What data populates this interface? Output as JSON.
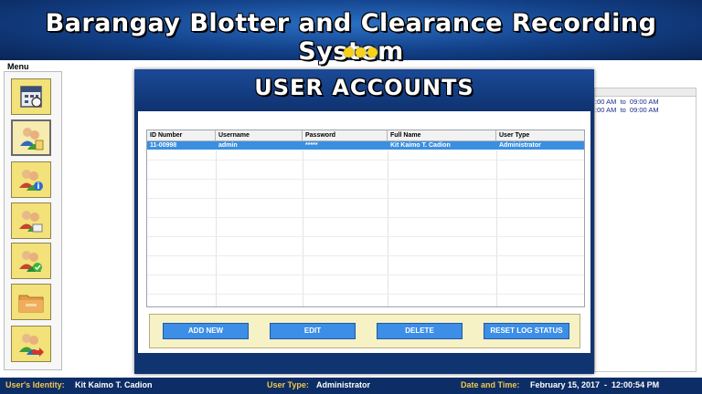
{
  "header": {
    "title": "Barangay Blotter and Clearance Recording System",
    "accent_color": "#f6d21a"
  },
  "menu": {
    "label": "Menu",
    "items": [
      {
        "icon": "calendar-icon"
      },
      {
        "icon": "users-icon",
        "active": true
      },
      {
        "icon": "user-info-icon"
      },
      {
        "icon": "users-edit-icon"
      },
      {
        "icon": "user-check-icon"
      },
      {
        "icon": "folder-icon"
      },
      {
        "icon": "user-logout-icon"
      }
    ]
  },
  "right_panel": {
    "lines": [
      ":00 AM  to  09:00 AM",
      ":00 AM  to  09:00 AM"
    ]
  },
  "dialog": {
    "title": "USER ACCOUNTS",
    "table": {
      "columns": [
        "ID Number",
        "Username",
        "Password",
        "Full Name",
        "User Type"
      ],
      "rows": [
        [
          "11-00998",
          "admin",
          "*****",
          "Kit Kaimo T. Cadion",
          "Administrator"
        ]
      ],
      "selected_row": 0
    },
    "buttons": {
      "add_new": "ADD NEW",
      "edit": "EDIT",
      "delete": "DELETE",
      "reset_log": "RESET LOG STATUS"
    }
  },
  "status_bar": {
    "identity_label": "User's Identity:",
    "identity_value": "Kit Kaimo T. Cadion",
    "type_label": "User Type:",
    "type_value": "Administrator",
    "datetime_label": "Date and Time:",
    "datetime_value": "February 15, 2017  -  12:00:54 PM"
  }
}
